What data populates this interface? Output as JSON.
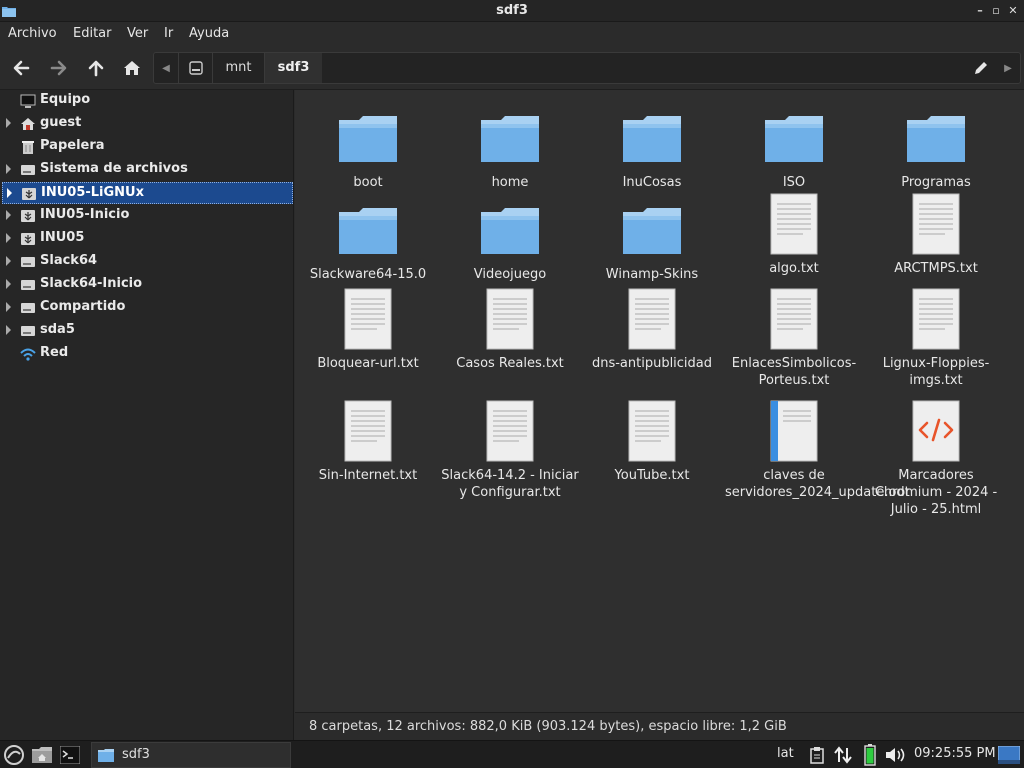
{
  "window": {
    "title": "sdf3"
  },
  "menu": [
    "Archivo",
    "Editar",
    "Ver",
    "Ir",
    "Ayuda"
  ],
  "pathbar": {
    "crumbs": [
      "mnt",
      "sdf3"
    ]
  },
  "sidebar": {
    "items": [
      {
        "label": "Equipo",
        "icon": "computer-icon",
        "expandable": false
      },
      {
        "label": "guest",
        "icon": "home-icon",
        "expandable": true
      },
      {
        "label": "Papelera",
        "icon": "trash-icon",
        "expandable": false
      },
      {
        "label": "Sistema de archivos",
        "icon": "drive-icon",
        "expandable": true
      },
      {
        "label": "INU05-LiGNUx",
        "icon": "usb-drive-icon",
        "expandable": true,
        "selected": true
      },
      {
        "label": "INU05-Inicio",
        "icon": "usb-drive-icon",
        "expandable": true
      },
      {
        "label": "INU05",
        "icon": "usb-drive-icon",
        "expandable": true
      },
      {
        "label": "Slack64",
        "icon": "drive-icon",
        "expandable": true
      },
      {
        "label": "Slack64-Inicio",
        "icon": "drive-icon",
        "expandable": true
      },
      {
        "label": "Compartido",
        "icon": "drive-icon",
        "expandable": true
      },
      {
        "label": "sda5",
        "icon": "drive-icon",
        "expandable": true
      },
      {
        "label": "Red",
        "icon": "network-icon",
        "expandable": false
      }
    ]
  },
  "files": [
    {
      "name": "boot",
      "type": "folder"
    },
    {
      "name": "home",
      "type": "folder"
    },
    {
      "name": "InuCosas",
      "type": "folder"
    },
    {
      "name": "ISO",
      "type": "folder"
    },
    {
      "name": "Programas",
      "type": "folder"
    },
    {
      "name": "Slackware64-15.0",
      "type": "folder"
    },
    {
      "name": "Videojuego",
      "type": "folder"
    },
    {
      "name": "Winamp-Skins",
      "type": "folder"
    },
    {
      "name": "algo.txt",
      "type": "text"
    },
    {
      "name": "ARCTMPS.txt",
      "type": "text"
    },
    {
      "name": "Bloquear-url.txt",
      "type": "text"
    },
    {
      "name": "Casos Reales.txt",
      "type": "text"
    },
    {
      "name": "dns-antipublicidad",
      "type": "text"
    },
    {
      "name": "EnlacesSimbolicos-Porteus.txt",
      "type": "text"
    },
    {
      "name": "Lignux-Floppies-imgs.txt",
      "type": "text"
    },
    {
      "name": "Sin-Internet.txt",
      "type": "text"
    },
    {
      "name": "Slack64-14.2 - Iniciar y Configurar.txt",
      "type": "text"
    },
    {
      "name": "YouTube.txt",
      "type": "text"
    },
    {
      "name": "claves de servidores_2024_update.odt",
      "type": "odt"
    },
    {
      "name": "Marcadores Chromium - 2024 - Julio - 25.html",
      "type": "html"
    }
  ],
  "statusbar": {
    "text": "8 carpetas, 12 archivos: 882,0 KiB (903.124 bytes), espacio libre: 1,2 GiB"
  },
  "taskbar": {
    "task_label": "sdf3",
    "keyboard_layout": "lat",
    "clock": "09:25:55 PM"
  },
  "colors": {
    "selection": "#1c4a8f",
    "folder": "#6fb0e8",
    "accent": "#3b82c4"
  }
}
